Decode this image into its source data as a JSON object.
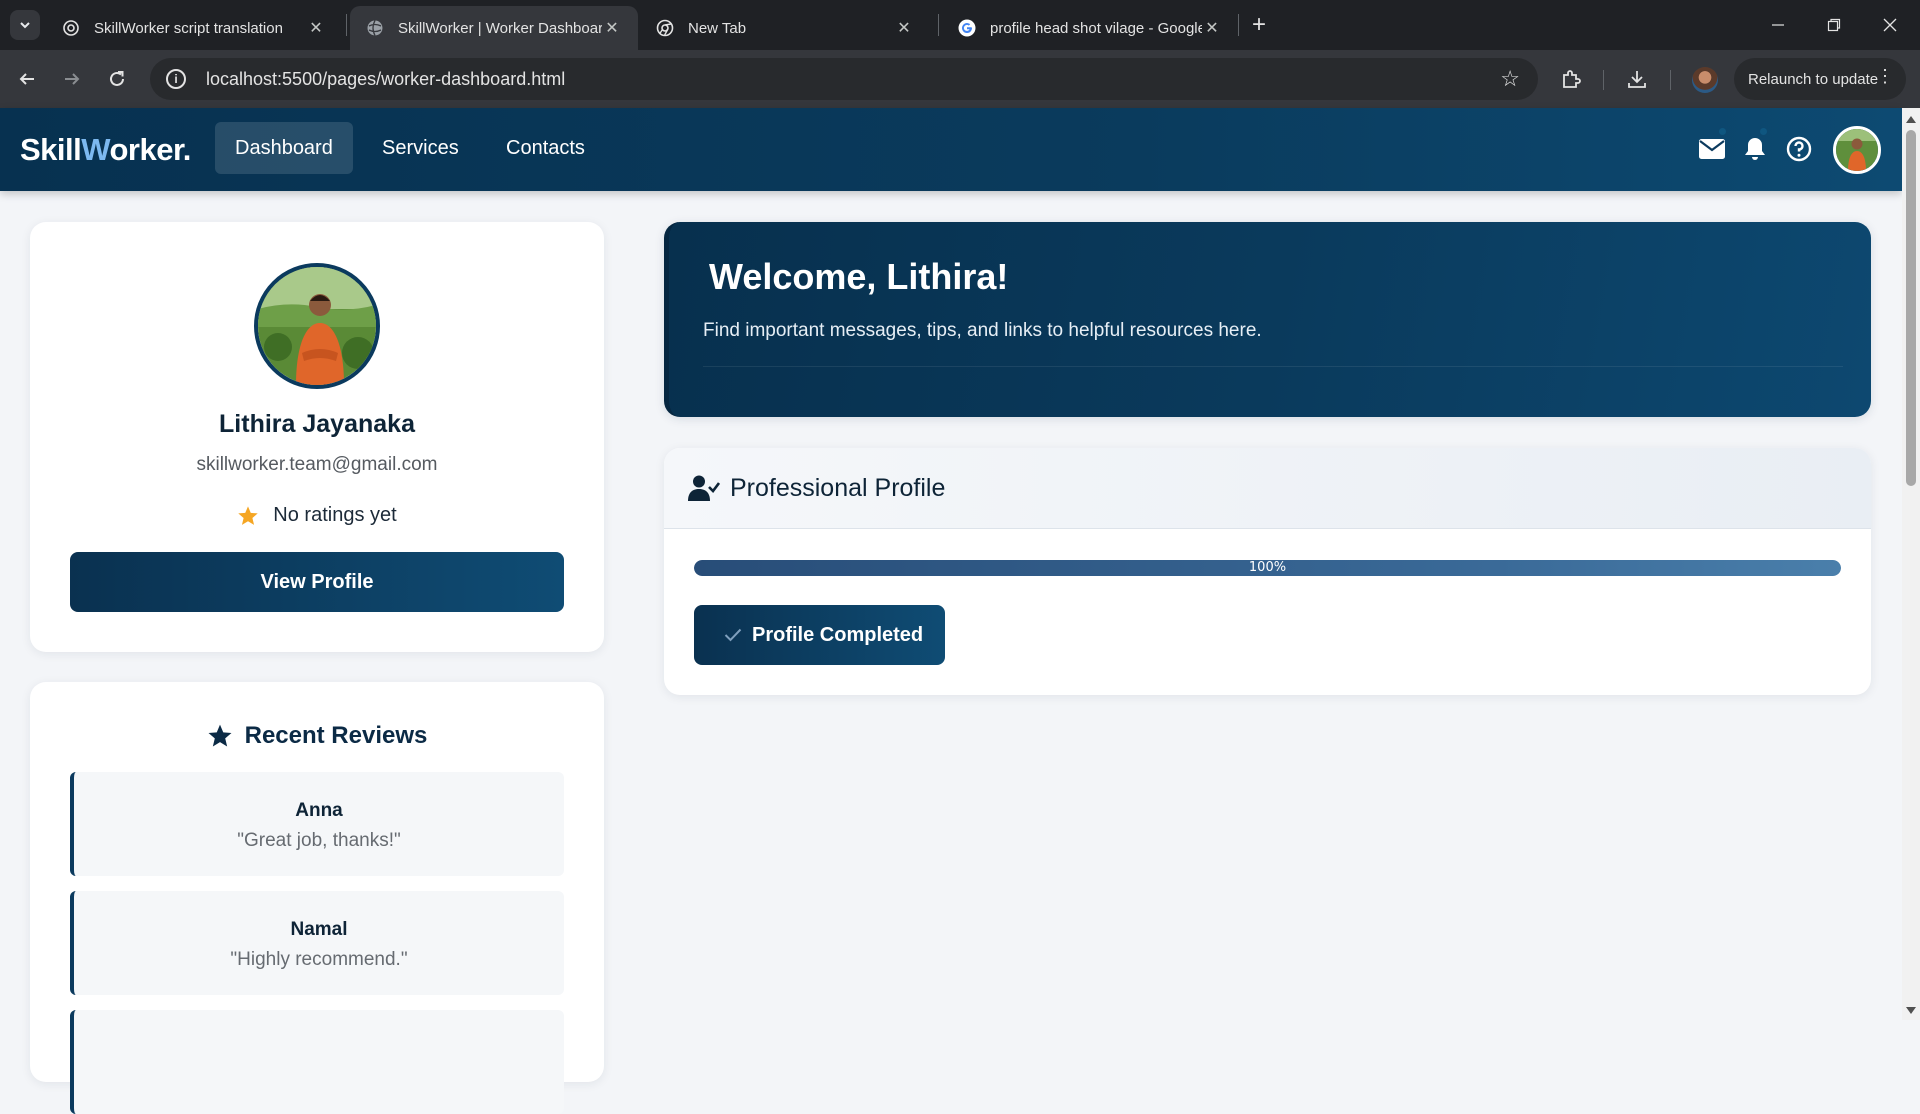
{
  "browser": {
    "tabs": [
      {
        "title": "SkillWorker script translation",
        "active": false
      },
      {
        "title": "SkillWorker | Worker Dashboard",
        "active": true
      },
      {
        "title": "New Tab",
        "active": false
      },
      {
        "title": "profile head shot vilage - Google",
        "active": false
      }
    ],
    "url": "localhost:5500/pages/worker-dashboard.html",
    "relaunch_label": "Relaunch to update"
  },
  "app": {
    "logo_part1": "Skill",
    "logo_accent": "W",
    "logo_part2": "orker.",
    "nav": [
      {
        "label": "Dashboard",
        "active": true
      },
      {
        "label": "Services",
        "active": false
      },
      {
        "label": "Contacts",
        "active": false
      }
    ]
  },
  "profile": {
    "name": "Lithira Jayanaka",
    "email": "skillworker.team@gmail.com",
    "rating_text": "No ratings yet",
    "view_button": "View Profile"
  },
  "reviews": {
    "title": "Recent Reviews",
    "items": [
      {
        "name": "Anna",
        "text": "\"Great job, thanks!\""
      },
      {
        "name": "Namal",
        "text": "\"Highly recommend.\""
      }
    ]
  },
  "welcome": {
    "heading": "Welcome, Lithira!",
    "subtitle": "Find important messages, tips, and links to helpful resources here."
  },
  "professional_profile": {
    "title": "Professional Profile",
    "progress_percent": 100,
    "progress_label": "100%",
    "status_button": "Profile Completed"
  },
  "colors": {
    "brand_navy": "#0a3a5c",
    "logo_accent": "#7cb9f0",
    "star": "#f5a623"
  }
}
